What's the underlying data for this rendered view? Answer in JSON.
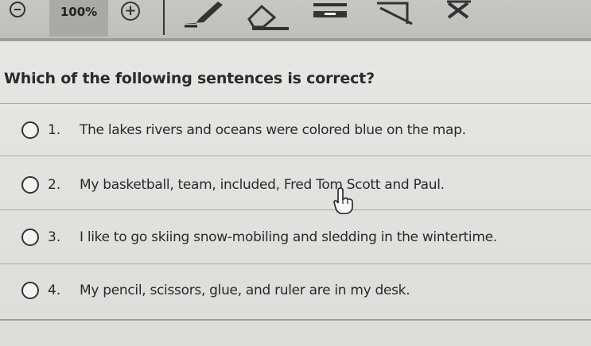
{
  "toolbar": {
    "zoom_level": "100%",
    "zoom_in_glyph": "+",
    "icons": [
      "zoom-out-icon",
      "zoom-in-icon",
      "pen-icon",
      "eraser-icon",
      "line-icon",
      "box-icon",
      "x-icon"
    ]
  },
  "question": {
    "text": "Which of the following sentences is correct?"
  },
  "options": [
    {
      "number": "1.",
      "text": "The lakes rivers and oceans were colored blue on the map."
    },
    {
      "number": "2.",
      "text": "My basketball, team, included, Fred Tom Scott and Paul."
    },
    {
      "number": "3.",
      "text": "I like to go skiing snow-mobiling and sledding in the wintertime."
    },
    {
      "number": "4.",
      "text": "My pencil, scissors, glue, and ruler are in my desk."
    }
  ],
  "colors": {
    "toolbar_bg": "#c6c6c3",
    "content_bg": "#e3e3e1",
    "text": "#2a2a2a"
  }
}
